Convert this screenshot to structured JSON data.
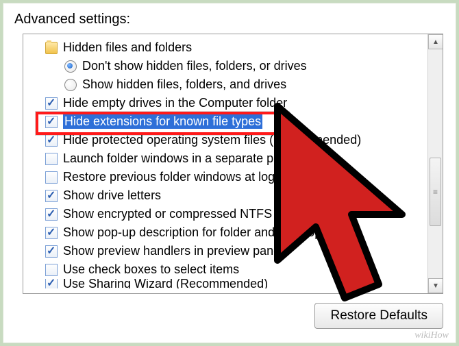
{
  "header": {
    "title": "Advanced settings:"
  },
  "tree": {
    "group_label": "Hidden files and folders",
    "radio_hidden_off": "Don't show hidden files, folders, or drives",
    "radio_hidden_on": "Show hidden files, folders, and drives",
    "opts": {
      "hide_empty_drives": "Hide empty drives in the Computer folder",
      "hide_extensions": "Hide extensions for known file types",
      "hide_protected_os": "Hide protected operating system files (Recommended)",
      "launch_separate": "Launch folder windows in a separate process",
      "restore_previous": "Restore previous folder windows at logon",
      "show_drive_letters": "Show drive letters",
      "show_encrypted_color": "Show encrypted or compressed NTFS files in color",
      "show_popup_desc": "Show pop-up description for folder and desktop items",
      "show_preview_handlers": "Show preview handlers in preview pane",
      "use_checkboxes": "Use check boxes to select items",
      "use_sharing_wizard": "Use Sharing Wizard (Recommended)"
    }
  },
  "state": {
    "radio_selected": "off",
    "checked": {
      "hide_empty_drives": true,
      "hide_extensions": true,
      "hide_protected_os": true,
      "launch_separate": false,
      "restore_previous": false,
      "show_drive_letters": true,
      "show_encrypted_color": true,
      "show_popup_desc": true,
      "show_preview_handlers": true,
      "use_checkboxes": false,
      "use_sharing_wizard": true
    },
    "highlighted_option": "hide_extensions"
  },
  "buttons": {
    "restore_defaults": "Restore Defaults"
  },
  "watermark": "wikiHow",
  "colors": {
    "highlight_bg": "#2e6fd8",
    "callout_border": "#ff1a1a",
    "cursor": "#d1211f"
  }
}
